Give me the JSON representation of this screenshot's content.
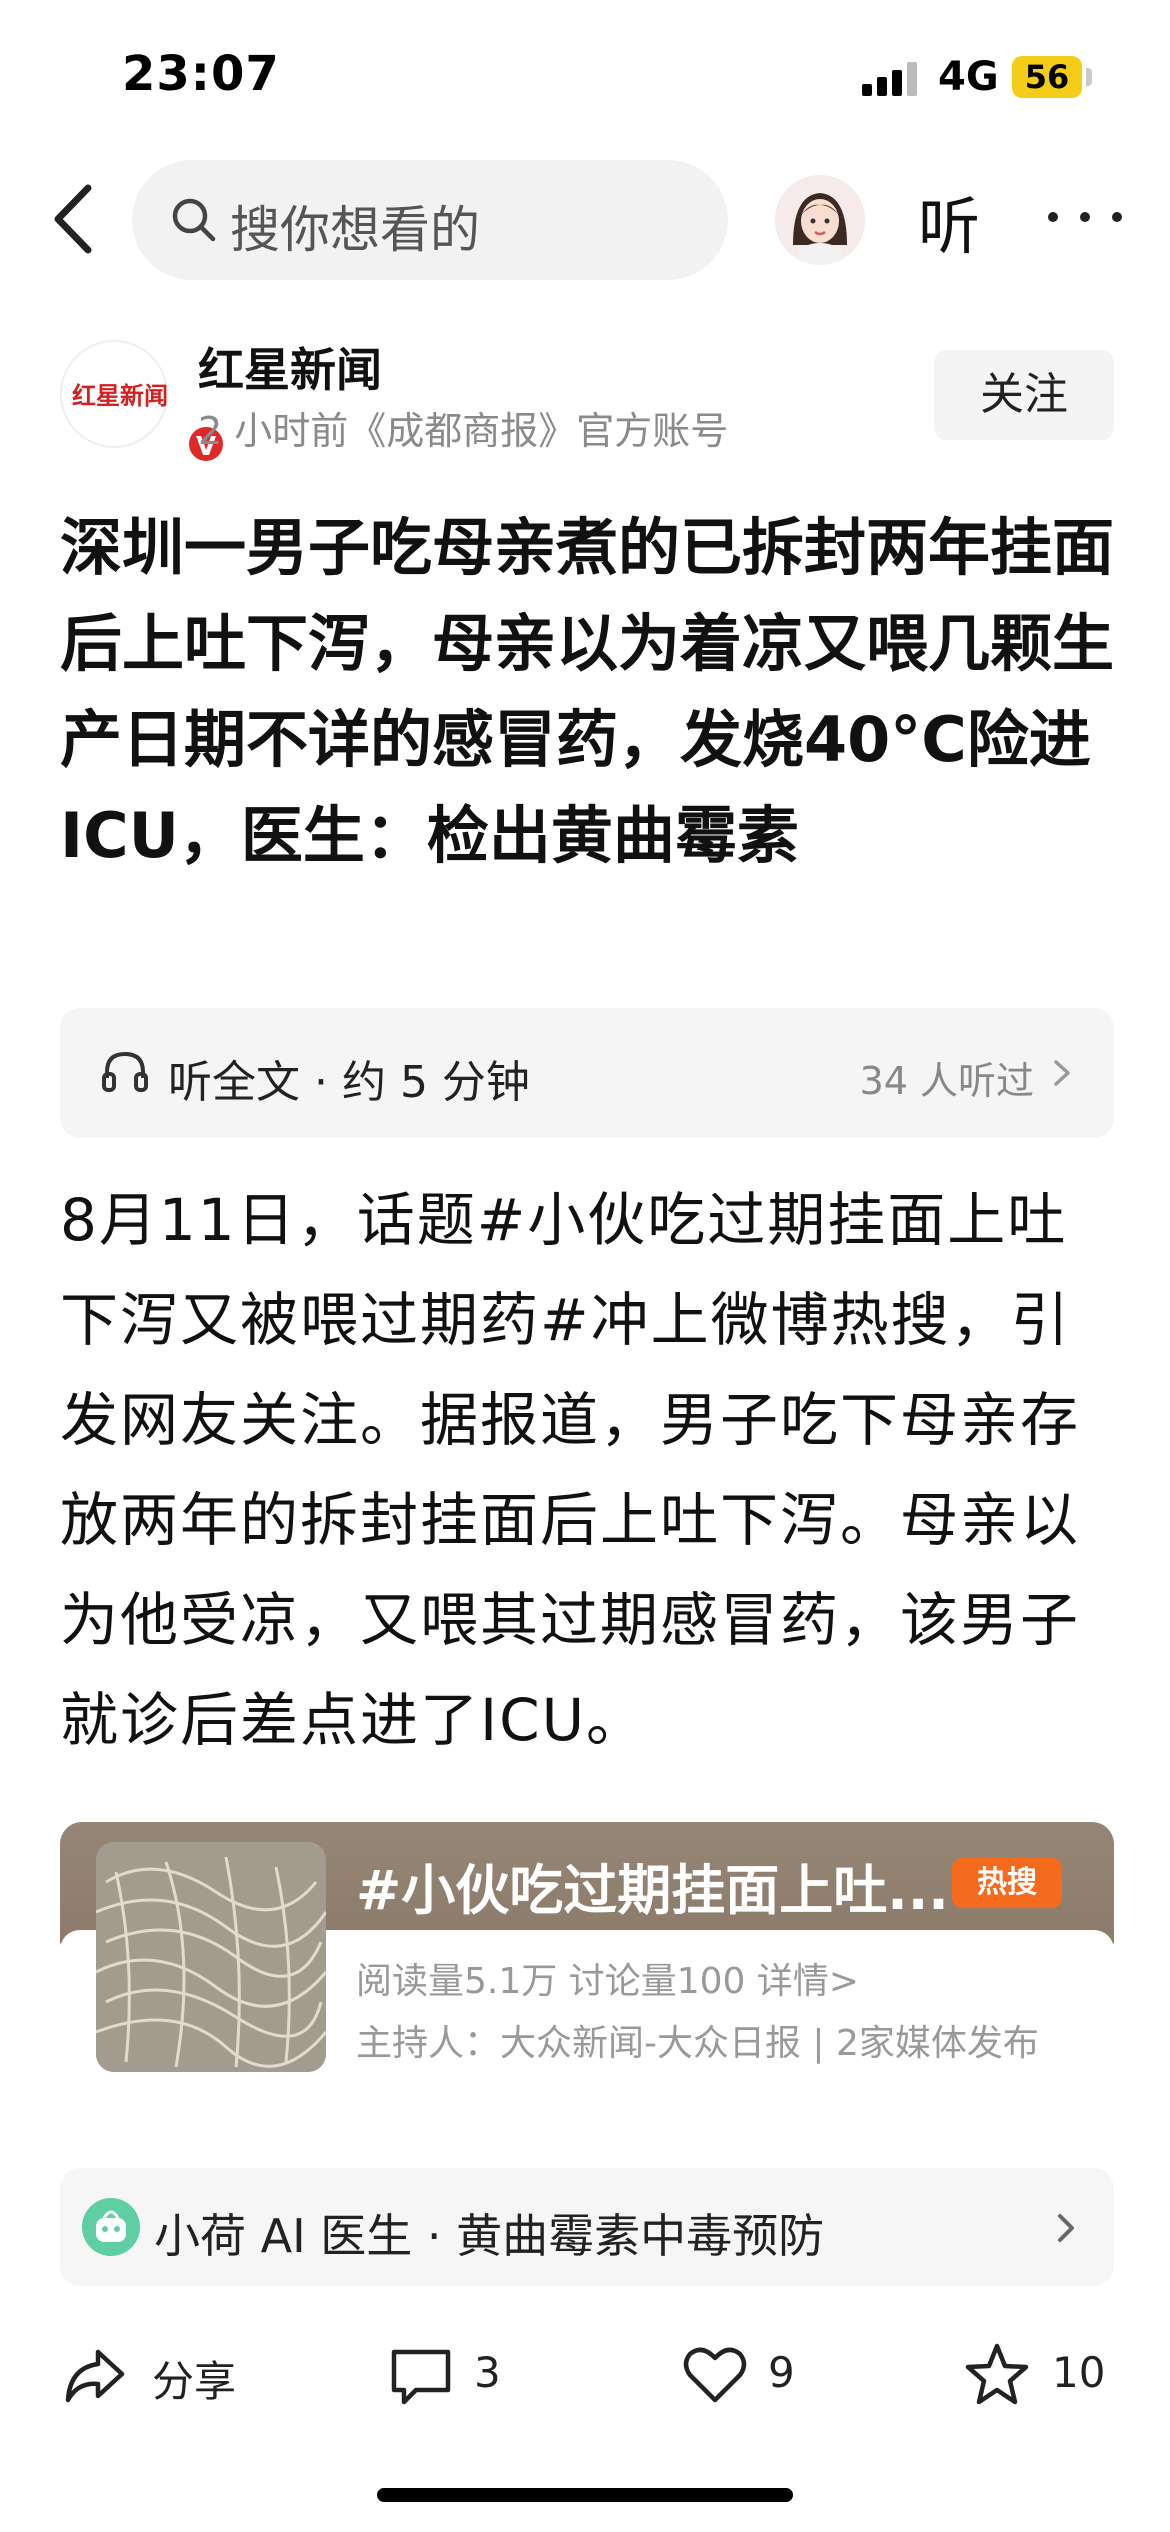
{
  "status_bar": {
    "time": "23:07",
    "network": "4G",
    "battery": "56"
  },
  "nav": {
    "search_placeholder": "搜你想看的",
    "listen_label": "听"
  },
  "author": {
    "name": "红星新闻",
    "meta": "2 小时前《成都商报》官方账号",
    "logo_text": "红星新闻",
    "verified_badge": "V",
    "follow_label": "关注"
  },
  "article": {
    "title": "深圳一男子吃母亲煮的已拆封两年挂面后上吐下泻，母亲以为着凉又喂几颗生产日期不详的感冒药，发烧40°C险进ICU，医生：检出黄曲霉素",
    "body": "8月11日，话题#小伙吃过期挂面上吐下泻又被喂过期药#冲上微博热搜，引发网友关注。据报道，男子吃下母亲存放两年的拆封挂面后上吐下泻。母亲以为他受凉，又喂其过期感冒药，该男子就诊后差点进了ICU。"
  },
  "listen_bar": {
    "label": "听全文 · 约 5 分钟",
    "count": "34 人听过"
  },
  "topic_card": {
    "title": "#小伙吃过期挂面上吐...",
    "badge": "热搜",
    "stats": "阅读量5.1万  讨论量100  详情>",
    "host": "主持人：大众新闻-大众日报 | 2家媒体发布"
  },
  "ai_doctor": {
    "label": "小荷 AI 医生 · 黄曲霉素中毒预防"
  },
  "actions": {
    "share": "分享",
    "comments": "3",
    "likes": "9",
    "favorites": "10"
  },
  "colors": {
    "accent_red": "#e02828",
    "hot_orange": "#f56b1e",
    "battery_yellow": "#f5cc18"
  }
}
